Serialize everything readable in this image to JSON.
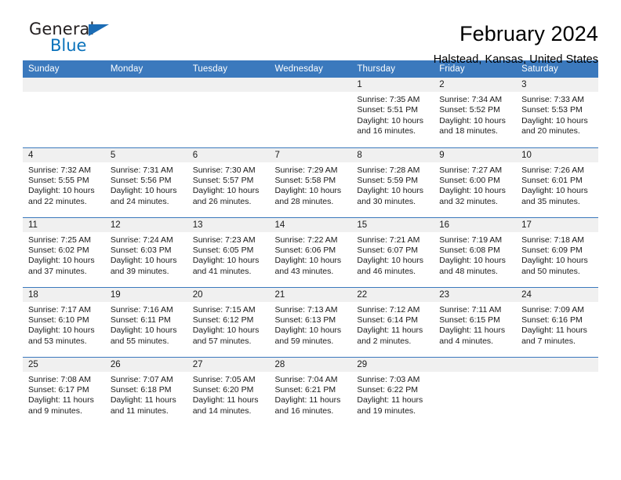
{
  "brand": {
    "line1": "General",
    "line2": "Blue",
    "flag_color": "#1b6cb5",
    "blue_color": "#0a72bb"
  },
  "header": {
    "title": "February 2024",
    "location": "Halstead, Kansas, United States"
  },
  "theme": {
    "header_bg": "#3b79bd",
    "date_strip_bg": "#f0f0f0",
    "separator": "#3b79bd"
  },
  "calendar": {
    "weekday_headers": [
      "Sunday",
      "Monday",
      "Tuesday",
      "Wednesday",
      "Thursday",
      "Friday",
      "Saturday"
    ],
    "weeks": [
      [
        {
          "day": "",
          "blank": true
        },
        {
          "day": "",
          "blank": true
        },
        {
          "day": "",
          "blank": true
        },
        {
          "day": "",
          "blank": true
        },
        {
          "day": "1",
          "sunrise": "Sunrise: 7:35 AM",
          "sunset": "Sunset: 5:51 PM",
          "daylight1": "Daylight: 10 hours",
          "daylight2": "and 16 minutes."
        },
        {
          "day": "2",
          "sunrise": "Sunrise: 7:34 AM",
          "sunset": "Sunset: 5:52 PM",
          "daylight1": "Daylight: 10 hours",
          "daylight2": "and 18 minutes."
        },
        {
          "day": "3",
          "sunrise": "Sunrise: 7:33 AM",
          "sunset": "Sunset: 5:53 PM",
          "daylight1": "Daylight: 10 hours",
          "daylight2": "and 20 minutes."
        }
      ],
      [
        {
          "day": "4",
          "sunrise": "Sunrise: 7:32 AM",
          "sunset": "Sunset: 5:55 PM",
          "daylight1": "Daylight: 10 hours",
          "daylight2": "and 22 minutes."
        },
        {
          "day": "5",
          "sunrise": "Sunrise: 7:31 AM",
          "sunset": "Sunset: 5:56 PM",
          "daylight1": "Daylight: 10 hours",
          "daylight2": "and 24 minutes."
        },
        {
          "day": "6",
          "sunrise": "Sunrise: 7:30 AM",
          "sunset": "Sunset: 5:57 PM",
          "daylight1": "Daylight: 10 hours",
          "daylight2": "and 26 minutes."
        },
        {
          "day": "7",
          "sunrise": "Sunrise: 7:29 AM",
          "sunset": "Sunset: 5:58 PM",
          "daylight1": "Daylight: 10 hours",
          "daylight2": "and 28 minutes."
        },
        {
          "day": "8",
          "sunrise": "Sunrise: 7:28 AM",
          "sunset": "Sunset: 5:59 PM",
          "daylight1": "Daylight: 10 hours",
          "daylight2": "and 30 minutes."
        },
        {
          "day": "9",
          "sunrise": "Sunrise: 7:27 AM",
          "sunset": "Sunset: 6:00 PM",
          "daylight1": "Daylight: 10 hours",
          "daylight2": "and 32 minutes."
        },
        {
          "day": "10",
          "sunrise": "Sunrise: 7:26 AM",
          "sunset": "Sunset: 6:01 PM",
          "daylight1": "Daylight: 10 hours",
          "daylight2": "and 35 minutes."
        }
      ],
      [
        {
          "day": "11",
          "sunrise": "Sunrise: 7:25 AM",
          "sunset": "Sunset: 6:02 PM",
          "daylight1": "Daylight: 10 hours",
          "daylight2": "and 37 minutes."
        },
        {
          "day": "12",
          "sunrise": "Sunrise: 7:24 AM",
          "sunset": "Sunset: 6:03 PM",
          "daylight1": "Daylight: 10 hours",
          "daylight2": "and 39 minutes."
        },
        {
          "day": "13",
          "sunrise": "Sunrise: 7:23 AM",
          "sunset": "Sunset: 6:05 PM",
          "daylight1": "Daylight: 10 hours",
          "daylight2": "and 41 minutes."
        },
        {
          "day": "14",
          "sunrise": "Sunrise: 7:22 AM",
          "sunset": "Sunset: 6:06 PM",
          "daylight1": "Daylight: 10 hours",
          "daylight2": "and 43 minutes."
        },
        {
          "day": "15",
          "sunrise": "Sunrise: 7:21 AM",
          "sunset": "Sunset: 6:07 PM",
          "daylight1": "Daylight: 10 hours",
          "daylight2": "and 46 minutes."
        },
        {
          "day": "16",
          "sunrise": "Sunrise: 7:19 AM",
          "sunset": "Sunset: 6:08 PM",
          "daylight1": "Daylight: 10 hours",
          "daylight2": "and 48 minutes."
        },
        {
          "day": "17",
          "sunrise": "Sunrise: 7:18 AM",
          "sunset": "Sunset: 6:09 PM",
          "daylight1": "Daylight: 10 hours",
          "daylight2": "and 50 minutes."
        }
      ],
      [
        {
          "day": "18",
          "sunrise": "Sunrise: 7:17 AM",
          "sunset": "Sunset: 6:10 PM",
          "daylight1": "Daylight: 10 hours",
          "daylight2": "and 53 minutes."
        },
        {
          "day": "19",
          "sunrise": "Sunrise: 7:16 AM",
          "sunset": "Sunset: 6:11 PM",
          "daylight1": "Daylight: 10 hours",
          "daylight2": "and 55 minutes."
        },
        {
          "day": "20",
          "sunrise": "Sunrise: 7:15 AM",
          "sunset": "Sunset: 6:12 PM",
          "daylight1": "Daylight: 10 hours",
          "daylight2": "and 57 minutes."
        },
        {
          "day": "21",
          "sunrise": "Sunrise: 7:13 AM",
          "sunset": "Sunset: 6:13 PM",
          "daylight1": "Daylight: 10 hours",
          "daylight2": "and 59 minutes."
        },
        {
          "day": "22",
          "sunrise": "Sunrise: 7:12 AM",
          "sunset": "Sunset: 6:14 PM",
          "daylight1": "Daylight: 11 hours",
          "daylight2": "and 2 minutes."
        },
        {
          "day": "23",
          "sunrise": "Sunrise: 7:11 AM",
          "sunset": "Sunset: 6:15 PM",
          "daylight1": "Daylight: 11 hours",
          "daylight2": "and 4 minutes."
        },
        {
          "day": "24",
          "sunrise": "Sunrise: 7:09 AM",
          "sunset": "Sunset: 6:16 PM",
          "daylight1": "Daylight: 11 hours",
          "daylight2": "and 7 minutes."
        }
      ],
      [
        {
          "day": "25",
          "sunrise": "Sunrise: 7:08 AM",
          "sunset": "Sunset: 6:17 PM",
          "daylight1": "Daylight: 11 hours",
          "daylight2": "and 9 minutes."
        },
        {
          "day": "26",
          "sunrise": "Sunrise: 7:07 AM",
          "sunset": "Sunset: 6:18 PM",
          "daylight1": "Daylight: 11 hours",
          "daylight2": "and 11 minutes."
        },
        {
          "day": "27",
          "sunrise": "Sunrise: 7:05 AM",
          "sunset": "Sunset: 6:20 PM",
          "daylight1": "Daylight: 11 hours",
          "daylight2": "and 14 minutes."
        },
        {
          "day": "28",
          "sunrise": "Sunrise: 7:04 AM",
          "sunset": "Sunset: 6:21 PM",
          "daylight1": "Daylight: 11 hours",
          "daylight2": "and 16 minutes."
        },
        {
          "day": "29",
          "sunrise": "Sunrise: 7:03 AM",
          "sunset": "Sunset: 6:22 PM",
          "daylight1": "Daylight: 11 hours",
          "daylight2": "and 19 minutes."
        },
        {
          "day": "",
          "blank": true
        },
        {
          "day": "",
          "blank": true
        }
      ]
    ]
  }
}
